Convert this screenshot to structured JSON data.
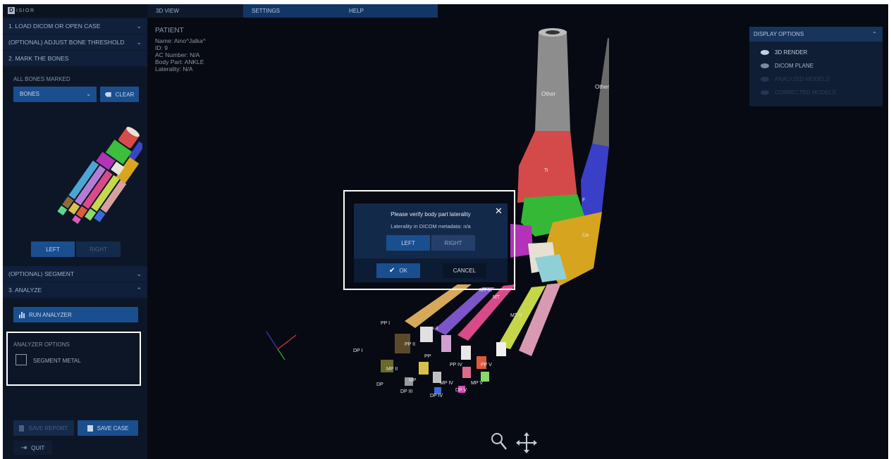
{
  "app": {
    "logo_text": "ISIOR",
    "logo_letter": "D"
  },
  "tabs": [
    {
      "label": "3D VIEW"
    },
    {
      "label": "SETTINGS"
    },
    {
      "label": "HELP"
    }
  ],
  "sidebar": {
    "steps": [
      {
        "label": "1. LOAD DICOM OR OPEN CASE"
      },
      {
        "label": "(OPTIONAL) ADJUST BONE THRESHOLD"
      },
      {
        "label": "2. MARK THE BONES"
      },
      {
        "label": "(OPTIONAL) SEGMENT"
      },
      {
        "label": "3. ANALYZE"
      }
    ],
    "all_bones_marked": "ALL BONES MARKED",
    "bones_select_value": "BONES",
    "clear_label": "CLEAR",
    "left_label": "LEFT",
    "right_label": "RIGHT",
    "run_analyzer_label": "RUN ANALYZER",
    "analyzer_options_label": "ANALYZER OPTIONS",
    "segment_metal_label": "SEGMENT METAL",
    "segment_metal_checked": false,
    "save_report_label": "SAVE REPORT",
    "save_case_label": "SAVE CASE",
    "quit_label": "QUIT"
  },
  "patient": {
    "heading": "PATIENT",
    "name": "Name: Aino^Jalka^",
    "id": "ID: 9",
    "ac_number": "AC Number: N/A",
    "body_part": "Body Part: ANKLE",
    "laterality": "Laterality: N/A"
  },
  "display_options": {
    "title": "DISPLAY OPTIONS",
    "items": [
      {
        "label": "3D RENDER",
        "enabled": true
      },
      {
        "label": "DICOM PLANE",
        "enabled": true
      },
      {
        "label": "ANALYZED MODELS",
        "enabled": false
      },
      {
        "label": "CORRECTED MODELS",
        "enabled": false
      }
    ]
  },
  "bone_labels": {
    "other1": "Other",
    "other2": "Other",
    "ti": "Ti",
    "f": "F",
    "ca": "Ca",
    "mt1": "MT III",
    "mt2": "MT",
    "mt5": "MT V",
    "pp1": "PP I",
    "pp2": "PP II",
    "pp3": "PP",
    "pp4": "PP IV",
    "pp5": "PP V",
    "dp1": "DP I",
    "mp2": "MP II",
    "mp3": "MP",
    "mp4": "MP IV",
    "mp5": "MP V",
    "dp2": "DP",
    "dp3": "DP III",
    "dp4": "DP IV",
    "dp5": "DP V",
    "se": "se II"
  },
  "dialog": {
    "title": "Please verify body part laterality",
    "subtitle": "Laterality in DICOM metadata: n/a",
    "left_label": "LEFT",
    "right_label": "RIGHT",
    "ok_label": "OK",
    "cancel_label": "CANCEL"
  },
  "colors": {
    "accent": "#1a4f8f",
    "sidebar_bg": "#0d1626",
    "viewport_bg": "#070a12"
  }
}
